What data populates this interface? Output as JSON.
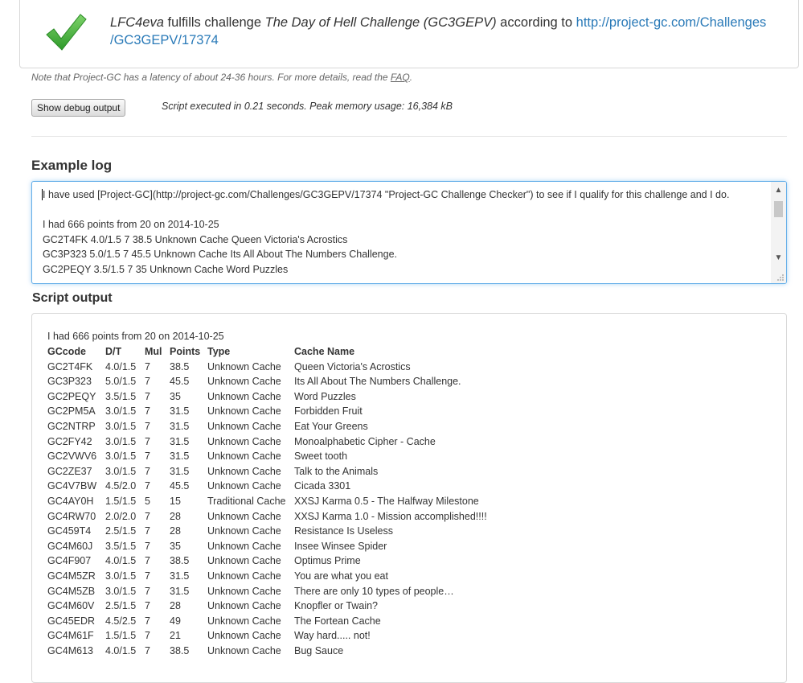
{
  "result": {
    "user": "LFC4eva",
    "verb": "fulfills challenge",
    "challenge": "The Day of Hell Challenge (GC3GEPV)",
    "according": "according to",
    "link_line1": "http://project-gc.com/Challenges",
    "link_line2": "/GC3GEPV/17374"
  },
  "latency": {
    "text": "Note that Project-GC has a latency of about 24-36 hours. For more details, read the",
    "link": "FAQ",
    "end": "."
  },
  "debug_button": "Show debug output",
  "exec_info": "Script executed in 0.21 seconds. Peak memory usage: 16,384 kB",
  "example_log": {
    "title": "Example log",
    "lines": [
      "I have used [Project-GC](http://project-gc.com/Challenges/GC3GEPV/17374 \"Project-GC Challenge Checker\") to see if I qualify for this challenge and I do.",
      "",
      "I had 666 points from 20 on 2014-10-25",
      "GC2T4FK 4.0/1.5 7 38.5 Unknown Cache Queen Victoria's Acrostics",
      "GC3P323 5.0/1.5 7 45.5 Unknown Cache Its All About The Numbers Challenge.",
      "GC2PEQY 3.5/1.5 7 35 Unknown Cache Word Puzzles"
    ]
  },
  "script_output": {
    "title": "Script output",
    "intro": "I had 666 points from 20 on 2014-10-25",
    "headers": [
      "GCcode",
      "D/T",
      "Mul",
      "Points",
      "Type",
      "Cache Name"
    ],
    "rows": [
      [
        "GC2T4FK",
        "4.0/1.5",
        "7",
        "38.5",
        "Unknown Cache",
        "Queen Victoria's Acrostics"
      ],
      [
        "GC3P323",
        "5.0/1.5",
        "7",
        "45.5",
        "Unknown Cache",
        "Its All About The Numbers Challenge."
      ],
      [
        "GC2PEQY",
        "3.5/1.5",
        "7",
        "35",
        "Unknown Cache",
        "Word Puzzles"
      ],
      [
        "GC2PM5A",
        "3.0/1.5",
        "7",
        "31.5",
        "Unknown Cache",
        "Forbidden Fruit"
      ],
      [
        "GC2NTRP",
        "3.0/1.5",
        "7",
        "31.5",
        "Unknown Cache",
        "Eat Your Greens"
      ],
      [
        "GC2FY42",
        "3.0/1.5",
        "7",
        "31.5",
        "Unknown Cache",
        "Monoalphabetic Cipher - Cache"
      ],
      [
        "GC2VWV6",
        "3.0/1.5",
        "7",
        "31.5",
        "Unknown Cache",
        "Sweet tooth"
      ],
      [
        "GC2ZE37",
        "3.0/1.5",
        "7",
        "31.5",
        "Unknown Cache",
        "Talk to the Animals"
      ],
      [
        "GC4V7BW",
        "4.5/2.0",
        "7",
        "45.5",
        "Unknown Cache",
        "Cicada 3301"
      ],
      [
        "GC4AY0H",
        "1.5/1.5",
        "5",
        "15",
        "Traditional Cache",
        "XXSJ Karma 0.5 - The Halfway Milestone"
      ],
      [
        "GC4RW70",
        "2.0/2.0",
        "7",
        "28",
        "Unknown Cache",
        "XXSJ Karma 1.0 - Mission accomplished!!!!"
      ],
      [
        "GC459T4",
        "2.5/1.5",
        "7",
        "28",
        "Unknown Cache",
        "Resistance Is Useless"
      ],
      [
        "GC4M60J",
        "3.5/1.5",
        "7",
        "35",
        "Unknown Cache",
        "Insee Winsee Spider"
      ],
      [
        "GC4F907",
        "4.0/1.5",
        "7",
        "38.5",
        "Unknown Cache",
        "Optimus Prime"
      ],
      [
        "GC4M5ZR",
        "3.0/1.5",
        "7",
        "31.5",
        "Unknown Cache",
        "You are what you eat"
      ],
      [
        "GC4M5ZB",
        "3.0/1.5",
        "7",
        "31.5",
        "Unknown Cache",
        "There are only 10 types of people…"
      ],
      [
        "GC4M60V",
        "2.5/1.5",
        "7",
        "28",
        "Unknown Cache",
        "Knopfler or Twain?"
      ],
      [
        "GC45EDR",
        "4.5/2.5",
        "7",
        "49",
        "Unknown Cache",
        "The Fortean Cache"
      ],
      [
        "GC4M61F",
        "1.5/1.5",
        "7",
        "21",
        "Unknown Cache",
        "Way hard..... not!"
      ],
      [
        "GC4M613",
        "4.0/1.5",
        "7",
        "38.5",
        "Unknown Cache",
        "Bug Sauce"
      ]
    ]
  },
  "colors": {
    "link": "#2a7ab8",
    "check": "#3aaa35",
    "focus": "#66afe9"
  }
}
